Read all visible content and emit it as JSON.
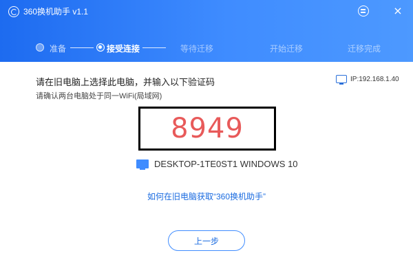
{
  "window": {
    "title": "360换机助手 v1.1",
    "logo_icon": "360-logo-icon",
    "feedback_icon": "feedback-bubble-icon",
    "close_label": "×"
  },
  "colors": {
    "header_start": "#1d6bf0",
    "header_end": "#4d99ff",
    "accent": "#3f8cff",
    "code_color": "#e85a5a",
    "link_color": "#1a6be0"
  },
  "steps": [
    {
      "label": "准备",
      "state": "done"
    },
    {
      "label": "接受连接",
      "state": "active"
    },
    {
      "label": "等待迁移",
      "state": "pending"
    },
    {
      "label": "开始迁移",
      "state": "pending"
    },
    {
      "label": "迁移完成",
      "state": "pending"
    }
  ],
  "instructions": {
    "title": "请在旧电脑上选择此电脑，并输入以下验证码",
    "subtitle": "请确认两台电脑处于同一WiFi(局域网)"
  },
  "ip": {
    "icon": "monitor-icon",
    "text": "IP:192.168.1.40"
  },
  "verification": {
    "code": "8949"
  },
  "device": {
    "icon": "computer-icon",
    "name": "DESKTOP-1TE0ST1 WINDOWS 10"
  },
  "help_link": "如何在旧电脑获取“360换机助手”",
  "buttons": {
    "back_label": "上一步"
  }
}
